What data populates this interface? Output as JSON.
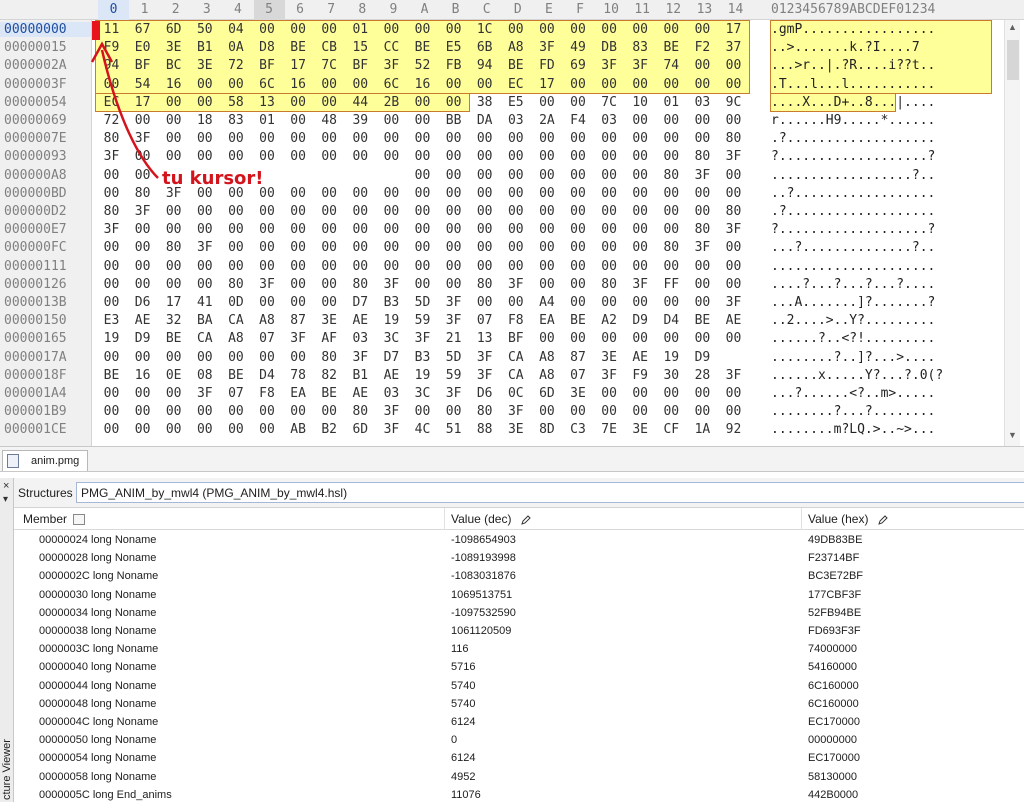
{
  "hex": {
    "columns": [
      "0",
      "1",
      "2",
      "3",
      "4",
      "5",
      "6",
      "7",
      "8",
      "9",
      "A",
      "B",
      "C",
      "D",
      "E",
      "F",
      "10",
      "11",
      "12",
      "13",
      "14"
    ],
    "ascii_header": "0123456789ABCDEF01234",
    "rows": [
      {
        "offset": "00000000",
        "bytes": [
          "11",
          "67",
          "6D",
          "50",
          "04",
          "00",
          "00",
          "00",
          "01",
          "00",
          "00",
          "00",
          "1C",
          "00",
          "00",
          "00",
          "00",
          "00",
          "00",
          "00",
          "17"
        ],
        "ascii": ".gmP................."
      },
      {
        "offset": "00000015",
        "bytes": [
          "F9",
          "E0",
          "3E",
          "B1",
          "0A",
          "D8",
          "BE",
          "CB",
          "15",
          "CC",
          "BE",
          "E5",
          "6B",
          "A8",
          "3F",
          "49",
          "DB",
          "83",
          "BE",
          "F2",
          "37"
        ],
        "ascii": "..>.......k.?I....7"
      },
      {
        "offset": "0000002A",
        "bytes": [
          "94",
          "BF",
          "BC",
          "3E",
          "72",
          "BF",
          "17",
          "7C",
          "BF",
          "3F",
          "52",
          "FB",
          "94",
          "BE",
          "FD",
          "69",
          "3F",
          "3F",
          "74",
          "00",
          "00"
        ],
        "ascii": "...>r..|.?R....i??t.."
      },
      {
        "offset": "0000003F",
        "bytes": [
          "00",
          "54",
          "16",
          "00",
          "00",
          "6C",
          "16",
          "00",
          "00",
          "6C",
          "16",
          "00",
          "00",
          "EC",
          "17",
          "00",
          "00",
          "00",
          "00",
          "00",
          "00"
        ],
        "ascii": ".T...l...l..........."
      },
      {
        "offset": "00000054",
        "bytes": [
          "EC",
          "17",
          "00",
          "00",
          "58",
          "13",
          "00",
          "00",
          "44",
          "2B",
          "00",
          "00",
          "38",
          "E5",
          "00",
          "00",
          "7C",
          "10",
          "01",
          "03",
          "9C"
        ],
        "ascii": "....X...D+..8...|...."
      },
      {
        "offset": "00000069",
        "bytes": [
          "72",
          "00",
          "00",
          "18",
          "83",
          "01",
          "00",
          "48",
          "39",
          "00",
          "00",
          "BB",
          "DA",
          "03",
          "2A",
          "F4",
          "03",
          "00",
          "00",
          "00",
          "00"
        ],
        "ascii": "r......H9.....*......"
      },
      {
        "offset": "0000007E",
        "bytes": [
          "80",
          "3F",
          "00",
          "00",
          "00",
          "00",
          "00",
          "00",
          "00",
          "00",
          "00",
          "00",
          "00",
          "00",
          "00",
          "00",
          "00",
          "00",
          "00",
          "00",
          "80"
        ],
        "ascii": ".?..................."
      },
      {
        "offset": "00000093",
        "bytes": [
          "3F",
          "00",
          "00",
          "00",
          "00",
          "00",
          "00",
          "00",
          "00",
          "00",
          "00",
          "00",
          "00",
          "00",
          "00",
          "00",
          "00",
          "00",
          "00",
          "80",
          "3F"
        ],
        "ascii": "?...................?"
      },
      {
        "offset": "000000A8",
        "bytes": [
          "00",
          "00",
          "",
          "",
          "",
          "",
          "",
          "",
          "",
          "",
          "00",
          "00",
          "00",
          "00",
          "00",
          "00",
          "00",
          "00",
          "80",
          "3F",
          "00"
        ],
        "ascii": "..................?.."
      },
      {
        "offset": "000000BD",
        "bytes": [
          "00",
          "80",
          "3F",
          "00",
          "00",
          "00",
          "00",
          "00",
          "00",
          "00",
          "00",
          "00",
          "00",
          "00",
          "00",
          "00",
          "00",
          "00",
          "00",
          "00",
          "00"
        ],
        "ascii": "..?.................."
      },
      {
        "offset": "000000D2",
        "bytes": [
          "80",
          "3F",
          "00",
          "00",
          "00",
          "00",
          "00",
          "00",
          "00",
          "00",
          "00",
          "00",
          "00",
          "00",
          "00",
          "00",
          "00",
          "00",
          "00",
          "00",
          "80"
        ],
        "ascii": ".?..................."
      },
      {
        "offset": "000000E7",
        "bytes": [
          "3F",
          "00",
          "00",
          "00",
          "00",
          "00",
          "00",
          "00",
          "00",
          "00",
          "00",
          "00",
          "00",
          "00",
          "00",
          "00",
          "00",
          "00",
          "00",
          "80",
          "3F"
        ],
        "ascii": "?...................?"
      },
      {
        "offset": "000000FC",
        "bytes": [
          "00",
          "00",
          "80",
          "3F",
          "00",
          "00",
          "00",
          "00",
          "00",
          "00",
          "00",
          "00",
          "00",
          "00",
          "00",
          "00",
          "00",
          "00",
          "80",
          "3F",
          "00"
        ],
        "ascii": "...?..............?.."
      },
      {
        "offset": "00000111",
        "bytes": [
          "00",
          "00",
          "00",
          "00",
          "00",
          "00",
          "00",
          "00",
          "00",
          "00",
          "00",
          "00",
          "00",
          "00",
          "00",
          "00",
          "00",
          "00",
          "00",
          "00",
          "00"
        ],
        "ascii": "....................."
      },
      {
        "offset": "00000126",
        "bytes": [
          "00",
          "00",
          "00",
          "00",
          "80",
          "3F",
          "00",
          "00",
          "80",
          "3F",
          "00",
          "00",
          "80",
          "3F",
          "00",
          "00",
          "80",
          "3F",
          "FF",
          "00",
          "00"
        ],
        "ascii": "....?...?...?...?...."
      },
      {
        "offset": "0000013B",
        "bytes": [
          "00",
          "D6",
          "17",
          "41",
          "0D",
          "00",
          "00",
          "00",
          "D7",
          "B3",
          "5D",
          "3F",
          "00",
          "00",
          "A4",
          "00",
          "00",
          "00",
          "00",
          "00",
          "3F"
        ],
        "ascii": "...A.......]?.......?"
      },
      {
        "offset": "00000150",
        "bytes": [
          "E3",
          "AE",
          "32",
          "BA",
          "CA",
          "A8",
          "87",
          "3E",
          "AE",
          "19",
          "59",
          "3F",
          "07",
          "F8",
          "EA",
          "BE",
          "A2",
          "D9",
          "D4",
          "BE",
          "AE"
        ],
        "ascii": "..2....>..Y?........."
      },
      {
        "offset": "00000165",
        "bytes": [
          "19",
          "D9",
          "BE",
          "CA",
          "A8",
          "07",
          "3F",
          "AF",
          "03",
          "3C",
          "3F",
          "21",
          "13",
          "BF",
          "00",
          "00",
          "00",
          "00",
          "00",
          "00",
          "00"
        ],
        "ascii": "......?..<?!........."
      },
      {
        "offset": "0000017A",
        "bytes": [
          "00",
          "00",
          "00",
          "00",
          "00",
          "00",
          "00",
          "80",
          "3F",
          "D7",
          "B3",
          "5D",
          "3F",
          "CA",
          "A8",
          "87",
          "3E",
          "AE",
          "19",
          "D9",
          ""
        ],
        "ascii": "........?..]?...>...."
      },
      {
        "offset": "0000018F",
        "bytes": [
          "BE",
          "16",
          "0E",
          "08",
          "BE",
          "D4",
          "78",
          "82",
          "B1",
          "AE",
          "19",
          "59",
          "3F",
          "CA",
          "A8",
          "07",
          "3F",
          "F9",
          "30",
          "28",
          "3F"
        ],
        "ascii": "......x.....Y?...?.0(?"
      },
      {
        "offset": "000001A4",
        "bytes": [
          "00",
          "00",
          "00",
          "3F",
          "07",
          "F8",
          "EA",
          "BE",
          "AE",
          "03",
          "3C",
          "3F",
          "D6",
          "0C",
          "6D",
          "3E",
          "00",
          "00",
          "00",
          "00",
          "00"
        ],
        "ascii": "...?......<?..m>....."
      },
      {
        "offset": "000001B9",
        "bytes": [
          "00",
          "00",
          "00",
          "00",
          "00",
          "00",
          "00",
          "00",
          "80",
          "3F",
          "00",
          "00",
          "80",
          "3F",
          "00",
          "00",
          "00",
          "00",
          "00",
          "00",
          "00"
        ],
        "ascii": "........?...?........"
      },
      {
        "offset": "000001CE",
        "bytes": [
          "00",
          "00",
          "00",
          "00",
          "00",
          "00",
          "AB",
          "B2",
          "6D",
          "3F",
          "4C",
          "51",
          "88",
          "3E",
          "8D",
          "C3",
          "7E",
          "3E",
          "CF",
          "1A",
          "92"
        ],
        "ascii": "........m?LQ.>..~>..."
      }
    ]
  },
  "annotation": {
    "text": "tu kursor!"
  },
  "file_tab": {
    "label": "anim.pmg"
  },
  "side_panel": {
    "close": "×",
    "pin": "▾",
    "title": "cture Viewer"
  },
  "structures": {
    "label": "Structures",
    "selected": "PMG_ANIM_by_mwl4 (PMG_ANIM_by_mwl4.hsl)",
    "headers": {
      "member": "Member",
      "dec": "Value (dec)",
      "hex": "Value (hex)"
    },
    "rows": [
      {
        "member": "00000024 long Noname",
        "dec": "-1098654903",
        "hex": "49DB83BE"
      },
      {
        "member": "00000028 long Noname",
        "dec": "-1089193998",
        "hex": "F23714BF"
      },
      {
        "member": "0000002C long Noname",
        "dec": "-1083031876",
        "hex": "BC3E72BF"
      },
      {
        "member": "00000030 long Noname",
        "dec": "1069513751",
        "hex": "177CBF3F"
      },
      {
        "member": "00000034 long Noname",
        "dec": "-1097532590",
        "hex": "52FB94BE"
      },
      {
        "member": "00000038 long Noname",
        "dec": "1061120509",
        "hex": "FD693F3F"
      },
      {
        "member": "0000003C long Noname",
        "dec": "116",
        "hex": "74000000"
      },
      {
        "member": "00000040 long Noname",
        "dec": "5716",
        "hex": "54160000"
      },
      {
        "member": "00000044 long Noname",
        "dec": "5740",
        "hex": "6C160000"
      },
      {
        "member": "00000048 long Noname",
        "dec": "5740",
        "hex": "6C160000"
      },
      {
        "member": "0000004C long Noname",
        "dec": "6124",
        "hex": "EC170000"
      },
      {
        "member": "00000050 long Noname",
        "dec": "0",
        "hex": "00000000"
      },
      {
        "member": "00000054 long Noname",
        "dec": "6124",
        "hex": "EC170000"
      },
      {
        "member": "00000058 long Noname",
        "dec": "4952",
        "hex": "58130000"
      },
      {
        "member": "0000005C long End_anims",
        "dec": "11076",
        "hex": "442B0000"
      }
    ]
  },
  "colors": {
    "highlight": "#ffff99",
    "highlight_border": "#c97a2a",
    "annotation": "#d4141c",
    "accent": "#1f4fa0"
  }
}
